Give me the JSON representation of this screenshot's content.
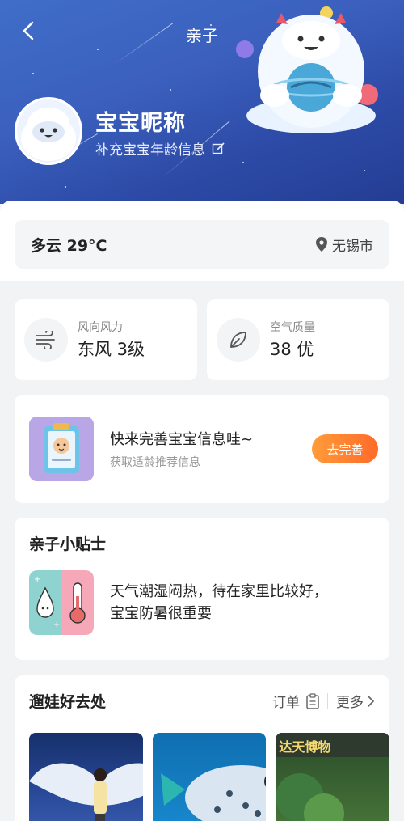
{
  "header": {
    "title": "亲子",
    "nickname": "宝宝昵称",
    "supplement": "补充宝宝年龄信息"
  },
  "weather": {
    "summary": "多云 29°C",
    "location": "无锡市"
  },
  "stats": [
    {
      "label": "风向风力",
      "value": "东风 3级",
      "icon": "wind-icon"
    },
    {
      "label": "空气质量",
      "value": "38 优",
      "icon": "leaf-icon"
    }
  ],
  "promo": {
    "title": "快来完善宝宝信息哇~",
    "subtitle": "获取适龄推荐信息",
    "button": "去完善"
  },
  "tips": {
    "title": "亲子小贴士",
    "text_line1": "天气潮湿闷热，待在家里比较好，",
    "text_line2": "宝宝防暑很重要"
  },
  "places": {
    "title": "遛娃好去处",
    "orders": "订单",
    "more": "更多",
    "thumb3_sign": "达天博物"
  },
  "colors": {
    "accent": "#ff7a2f",
    "header_bg": "#3b5fbd"
  }
}
